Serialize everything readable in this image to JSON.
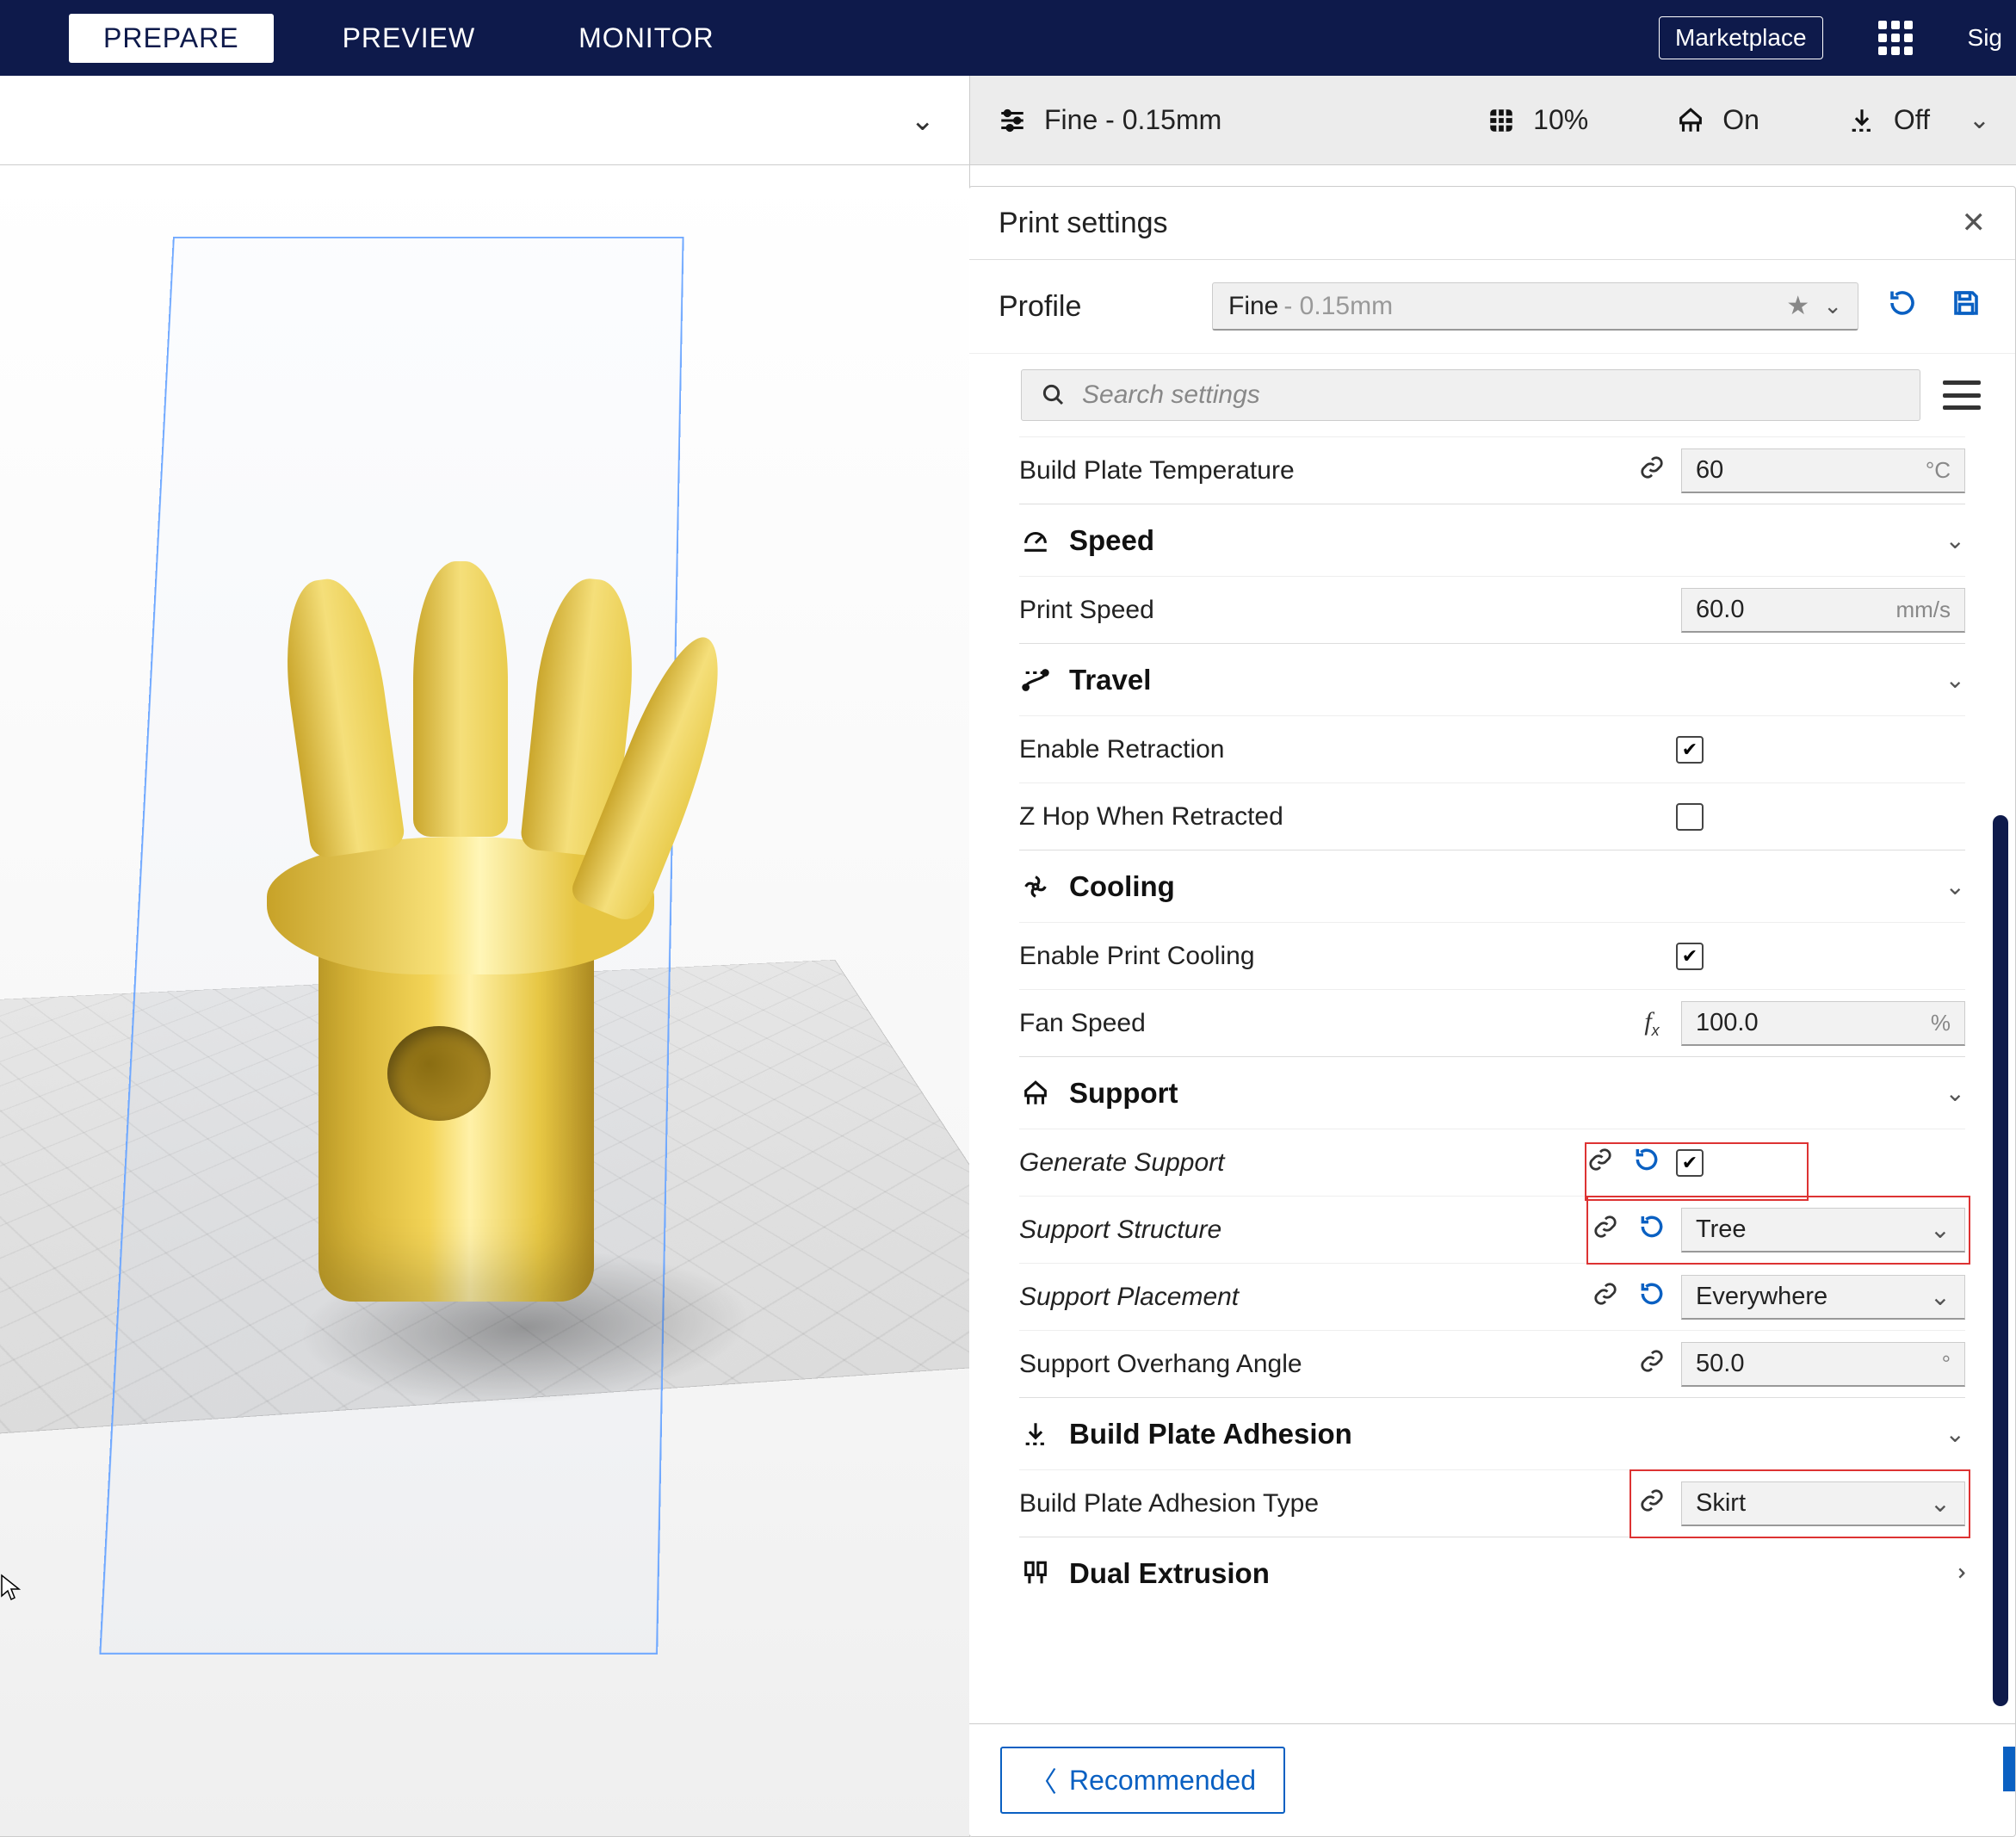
{
  "nav": {
    "prepare": "PREPARE",
    "preview": "PREVIEW",
    "monitor": "MONITOR",
    "marketplace": "Marketplace",
    "signin": "Sig"
  },
  "summary": {
    "profile": "Fine - 0.15mm",
    "infill": "10%",
    "support": "On",
    "adhesion": "Off"
  },
  "panel": {
    "title": "Print settings",
    "profile_label": "Profile",
    "profile_name": "Fine",
    "profile_detail": "- 0.15mm",
    "search_placeholder": "Search settings",
    "recommended": "Recommended"
  },
  "settings": {
    "build_plate_temp": {
      "label": "Build Plate Temperature",
      "value": "60",
      "unit": "°C"
    },
    "speed_section": "Speed",
    "print_speed": {
      "label": "Print Speed",
      "value": "60.0",
      "unit": "mm/s"
    },
    "travel_section": "Travel",
    "enable_retraction": {
      "label": "Enable Retraction",
      "checked": true
    },
    "z_hop": {
      "label": "Z Hop When Retracted",
      "checked": false
    },
    "cooling_section": "Cooling",
    "enable_cooling": {
      "label": "Enable Print Cooling",
      "checked": true
    },
    "fan_speed": {
      "label": "Fan Speed",
      "value": "100.0",
      "unit": "%"
    },
    "support_section": "Support",
    "generate_support": {
      "label": "Generate Support",
      "checked": true
    },
    "support_structure": {
      "label": "Support Structure",
      "value": "Tree"
    },
    "support_placement": {
      "label": "Support Placement",
      "value": "Everywhere"
    },
    "support_overhang": {
      "label": "Support Overhang Angle",
      "value": "50.0",
      "unit": "°"
    },
    "adhesion_section": "Build Plate Adhesion",
    "adhesion_type": {
      "label": "Build Plate Adhesion Type",
      "value": "Skirt"
    },
    "dual_section": "Dual Extrusion"
  }
}
